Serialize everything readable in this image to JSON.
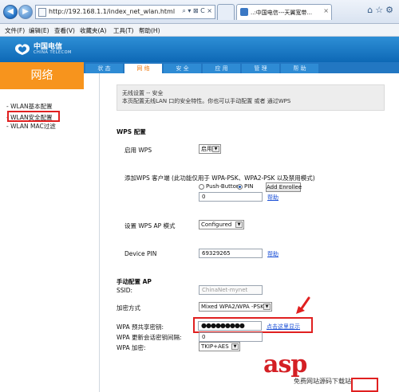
{
  "browser": {
    "url": "http://192.168.1.1/index_net_wlan.html",
    "address_tools": "⌕ ▾ ⊠ C ×",
    "tab_label": "..:中国电信---天翼宽带...",
    "tab_close": "×",
    "back_glyph": "◀",
    "forward_glyph": "▶",
    "right_icons": "⌂☆⚙",
    "menu": [
      "文件(F)",
      "编辑(E)",
      "查看(V)",
      "收藏夹(A)",
      "工具(T)",
      "帮助(H)"
    ]
  },
  "router": {
    "logo_text": "中国电信",
    "logo_sub": "CHINA TELECOM",
    "section_title": "网络",
    "tabs": [
      {
        "label": "状 态",
        "active": false
      },
      {
        "label": "网 络",
        "active": true
      },
      {
        "label": "安 全",
        "active": false
      },
      {
        "label": "应 用",
        "active": false
      },
      {
        "label": "管 理",
        "active": false
      },
      {
        "label": "帮 助",
        "active": false
      }
    ]
  },
  "sidebar": {
    "items": [
      {
        "label": "- WLAN基本配置",
        "active": false
      },
      {
        "label": "- WLAN安全配置",
        "active": true
      },
      {
        "label": "- WLAN MAC过滤",
        "active": false
      }
    ]
  },
  "info": {
    "title": "无线设置 -- 安全",
    "desc": "本页配置无线LAN 口的安全特性。你也可以手动配置 或者 通过WPS"
  },
  "wps": {
    "heading": "WPS 配置",
    "enable_label": "启用 WPS",
    "enable_value": "启用",
    "add_client_label": "添加WPS 客户端 (此功能仅用于 WPA-PSK、WPA2-PSK 以及禁用模式)",
    "push_button_label": "Push-Button",
    "pin_label": "PIN",
    "pin_selected": true,
    "pin_value": "0",
    "add_enrollee_label": "Add Enrollee",
    "help_label": "帮助",
    "ap_mode_label": "设置 WPS AP 模式",
    "ap_mode_value": "Configured",
    "device_pin_label": "Device PIN",
    "device_pin_value": "69329265",
    "device_pin_help": "帮助"
  },
  "manual": {
    "heading": "手动配置 AP",
    "ssid_label": "SSID:",
    "ssid_value": "ChinaNet-mynet",
    "encryption_label": "加密方式",
    "encryption_value": "Mixed WPA2/WPA -PSK",
    "psk_label": "WPA 预共享密钥:",
    "psk_value": "●●●●●●●●●",
    "show_password_link": "点击这里显示",
    "rekey_label": "WPA 更新会话密钥间隔:",
    "rekey_value": "0",
    "wpa_encryption_label": "WPA 加密:",
    "wpa_encryption_value": "TKIP+AES"
  },
  "watermark": {
    "brand": "asp",
    "sub": "免费网站源码下载站"
  },
  "colors": {
    "header_blue": "#0d68b5",
    "section_orange": "#f7941d",
    "highlight_red": "#e02020",
    "link_blue": "#1a4fd6"
  }
}
